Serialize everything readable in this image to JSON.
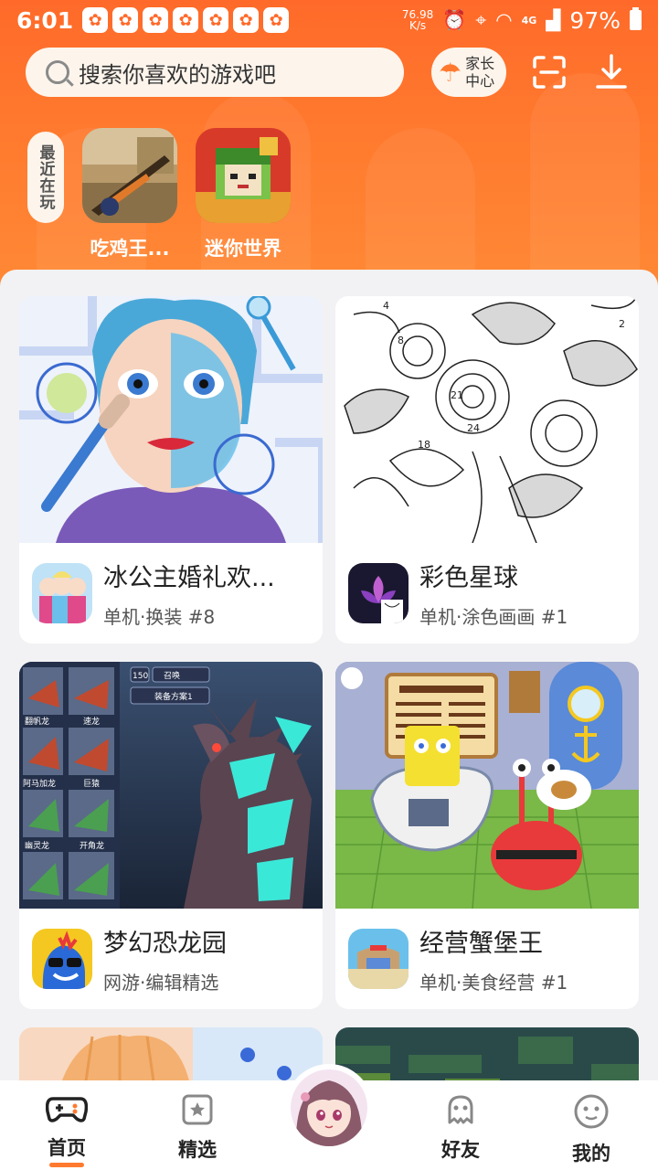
{
  "status": {
    "time": "6:01",
    "net_speed_value": "76.98",
    "net_speed_unit": "K/s",
    "network": "4G",
    "battery": "97%"
  },
  "header": {
    "search_placeholder": "搜索你喜欢的游戏吧",
    "parent_center_line1": "家长",
    "parent_center_line2": "中心"
  },
  "recent": {
    "label": "最近在玩",
    "games": [
      {
        "name": "吃鸡王..."
      },
      {
        "name": "迷你世界"
      }
    ]
  },
  "cards": [
    {
      "title": "冰公主婚礼欢...",
      "subtitle": "单机·换装 #8"
    },
    {
      "title": "彩色星球",
      "subtitle": "单机·涂色画画 #1"
    },
    {
      "title": "梦幻恐龙园",
      "subtitle": "网游·编辑精选"
    },
    {
      "title": "经营蟹堡王",
      "subtitle": "单机·美食经营 #1"
    }
  ],
  "card_overlays": {
    "coloring_numbers": [
      "4",
      "2",
      "8",
      "21",
      "24",
      "18"
    ],
    "dino_labels": [
      "150",
      "召唤",
      "装备方案1",
      "翻帆龙",
      "速龙",
      "阿马加龙",
      "巨猿",
      "幽灵龙",
      "开角龙"
    ]
  },
  "nav": {
    "home": "首页",
    "featured": "精选",
    "friends": "好友",
    "mine": "我的"
  },
  "colors": {
    "brand_orange": "#ff6a2a",
    "active_underline": "#ff7a2e"
  }
}
